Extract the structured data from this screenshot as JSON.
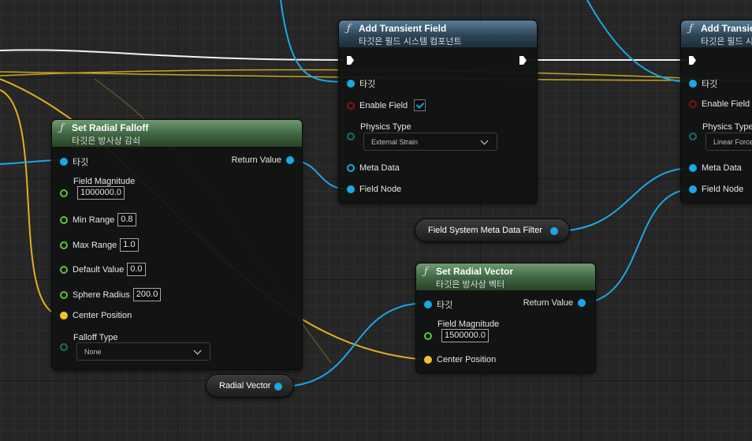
{
  "colors": {
    "object_pin": "#1ca7e6",
    "vector_pin": "#f2c12a",
    "float_pin": "#5fc33a",
    "bool_pin": "#8a1111",
    "enum_pin": "#1e6a6a",
    "func_header_blue": "#2c4558",
    "func_header_green": "#3e6440"
  },
  "icons": {
    "function": "ƒ",
    "exec_pin": "exec-arrow-icon",
    "dropdown": "chevron-down-icon",
    "checkbox": "check-icon"
  },
  "add_field_1": {
    "title": "Add Transient Field",
    "subtitle": "타깃은 필드 시스템 컴포넌트",
    "target": "타깃",
    "enable_field": "Enable Field",
    "enable_checked": true,
    "physics_type": "Physics Type",
    "physics_value": "External Strain",
    "meta_data": "Meta Data",
    "field_node": "Field Node"
  },
  "add_field_2": {
    "title": "Add Transient Field",
    "subtitle": "타깃은 필드 시스템 컴포넌트",
    "target": "타깃",
    "enable_field": "Enable Field",
    "physics_type": "Physics Type",
    "physics_value": "Linear Force",
    "meta_data": "Meta Data",
    "field_node": "Field Node"
  },
  "falloff": {
    "title": "Set Radial Falloff",
    "subtitle": "타깃은 방사상 감쇠",
    "target": "타깃",
    "return_value": "Return Value",
    "field_magnitude": "Field Magnitude",
    "field_magnitude_value": "1000000.0",
    "min_range": "Min Range",
    "min_range_value": "0.8",
    "max_range": "Max Range",
    "max_range_value": "1.0",
    "default_value": "Default Value",
    "default_value_value": "0.0",
    "sphere_radius": "Sphere Radius",
    "sphere_radius_value": "200.0",
    "center_position": "Center Position",
    "falloff_type": "Falloff Type",
    "falloff_type_value": "None"
  },
  "vector": {
    "title": "Set Radial Vector",
    "subtitle": "타깃은 방사상 벡터",
    "target": "타깃",
    "return_value": "Return Value",
    "field_magnitude": "Field Magnitude",
    "field_magnitude_value": "1500000.0",
    "center_position": "Center Position"
  },
  "meta_filter": {
    "label": "Field System Meta Data Filter"
  },
  "radial_vector_var": {
    "label": "Radial Vector"
  }
}
